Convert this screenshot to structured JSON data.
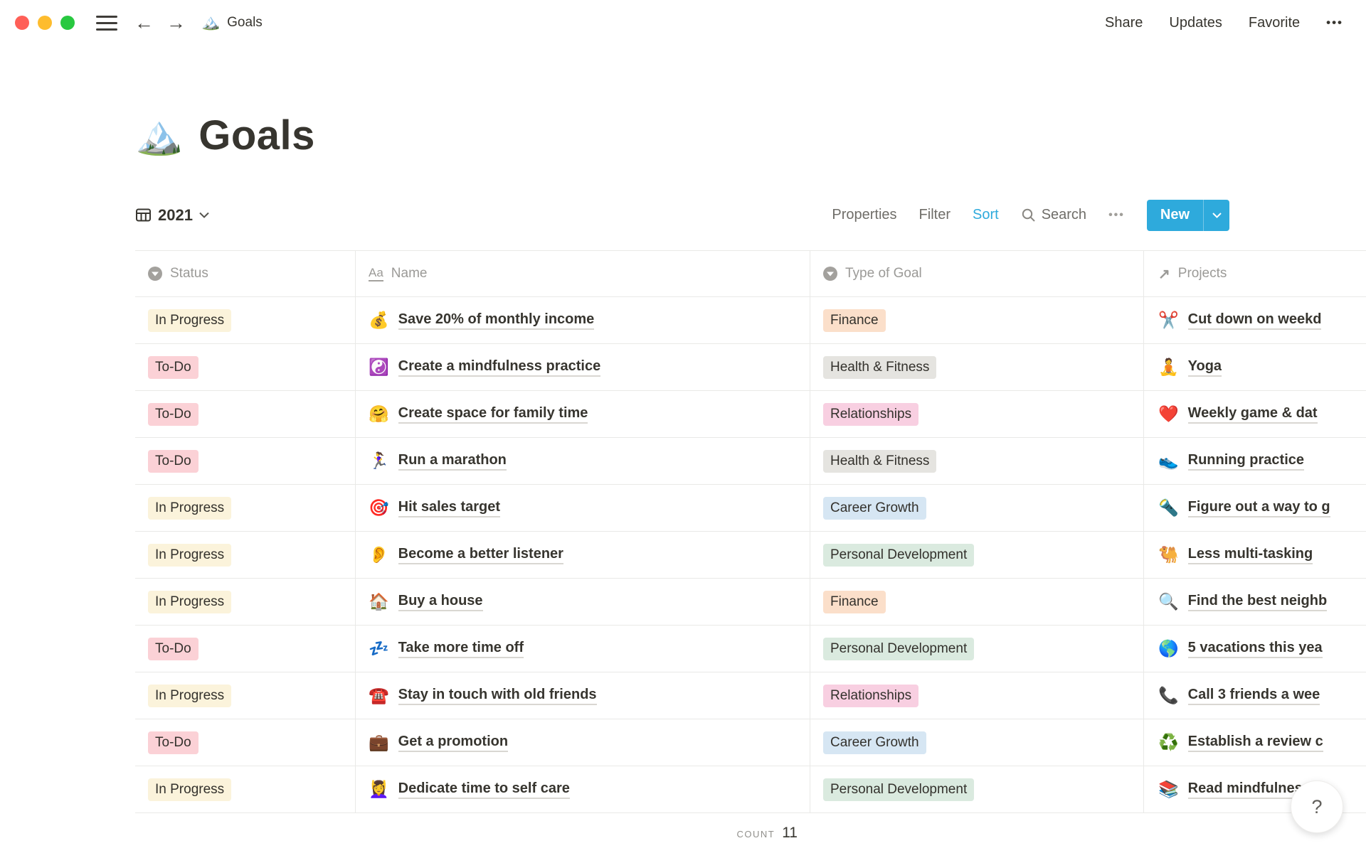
{
  "window": {
    "doc_icon": "🏔️",
    "doc_title": "Goals"
  },
  "topbar": {
    "share": "Share",
    "updates": "Updates",
    "favorite": "Favorite",
    "more": "•••"
  },
  "page": {
    "icon": "🏔️",
    "title": "Goals"
  },
  "toolbar": {
    "view_name": "2021",
    "properties": "Properties",
    "filter": "Filter",
    "sort": "Sort",
    "search": "Search",
    "more": "•••",
    "new_label": "New"
  },
  "table": {
    "columns": [
      {
        "label": "Status"
      },
      {
        "label": "Name"
      },
      {
        "label": "Type of Goal"
      },
      {
        "label": "Projects"
      }
    ],
    "rows": [
      {
        "status": "In Progress",
        "status_color": "yellow",
        "icon": "💰",
        "name": "Save 20% of monthly income",
        "type": "Finance",
        "type_color": "orange",
        "project_icon": "✂️",
        "project": "Cut down on weekd"
      },
      {
        "status": "To-Do",
        "status_color": "pink",
        "icon": "☯️",
        "name": "Create a mindfulness practice",
        "type": "Health & Fitness",
        "type_color": "gray",
        "project_icon": "🧘",
        "project": "Yoga"
      },
      {
        "status": "To-Do",
        "status_color": "pink",
        "icon": "🤗",
        "name": "Create space for family time",
        "type": "Relationships",
        "type_color": "magenta",
        "project_icon": "❤️",
        "project": "Weekly game & dat"
      },
      {
        "status": "To-Do",
        "status_color": "pink",
        "icon": "🏃‍♀️",
        "name": "Run a marathon",
        "type": "Health & Fitness",
        "type_color": "gray",
        "project_icon": "👟",
        "project": "Running practice"
      },
      {
        "status": "In Progress",
        "status_color": "yellow",
        "icon": "🎯",
        "name": "Hit sales target",
        "type": "Career Growth",
        "type_color": "blue",
        "project_icon": "🔦",
        "project": "Figure out a way to g"
      },
      {
        "status": "In Progress",
        "status_color": "yellow",
        "icon": "👂",
        "name": "Become a better listener",
        "type": "Personal Development",
        "type_color": "green",
        "project_icon": "🐫",
        "project": "Less multi-tasking"
      },
      {
        "status": "In Progress",
        "status_color": "yellow",
        "icon": "🏠",
        "name": "Buy a house",
        "type": "Finance",
        "type_color": "orange",
        "project_icon": "🔍",
        "project": "Find the best neighb"
      },
      {
        "status": "To-Do",
        "status_color": "pink",
        "icon": "💤",
        "name": "Take more time off",
        "type": "Personal Development",
        "type_color": "green",
        "project_icon": "🌎",
        "project": "5 vacations this yea"
      },
      {
        "status": "In Progress",
        "status_color": "yellow",
        "icon": "☎️",
        "name": "Stay in touch with old friends",
        "type": "Relationships",
        "type_color": "magenta",
        "project_icon": "📞",
        "project": "Call 3 friends a wee"
      },
      {
        "status": "To-Do",
        "status_color": "pink",
        "icon": "💼",
        "name": "Get a promotion",
        "type": "Career Growth",
        "type_color": "blue",
        "project_icon": "♻️",
        "project": "Establish a review c"
      },
      {
        "status": "In Progress",
        "status_color": "yellow",
        "icon": "💆‍♀️",
        "name": "Dedicate time to self care",
        "type": "Personal Development",
        "type_color": "green",
        "project_icon": "📚",
        "project": "Read mindfulness b"
      }
    ],
    "count_label": "COUNT",
    "count_value": "11"
  },
  "help": {
    "label": "?"
  },
  "colors": {
    "accent": "#2eaadc",
    "yellow": "#fbf3db",
    "pink": "#fbd1d6",
    "orange": "#fbdfca",
    "gray": "#e5e4e0",
    "magenta": "#f8cfe1",
    "blue": "#d6e6f3",
    "green": "#daeadf"
  }
}
